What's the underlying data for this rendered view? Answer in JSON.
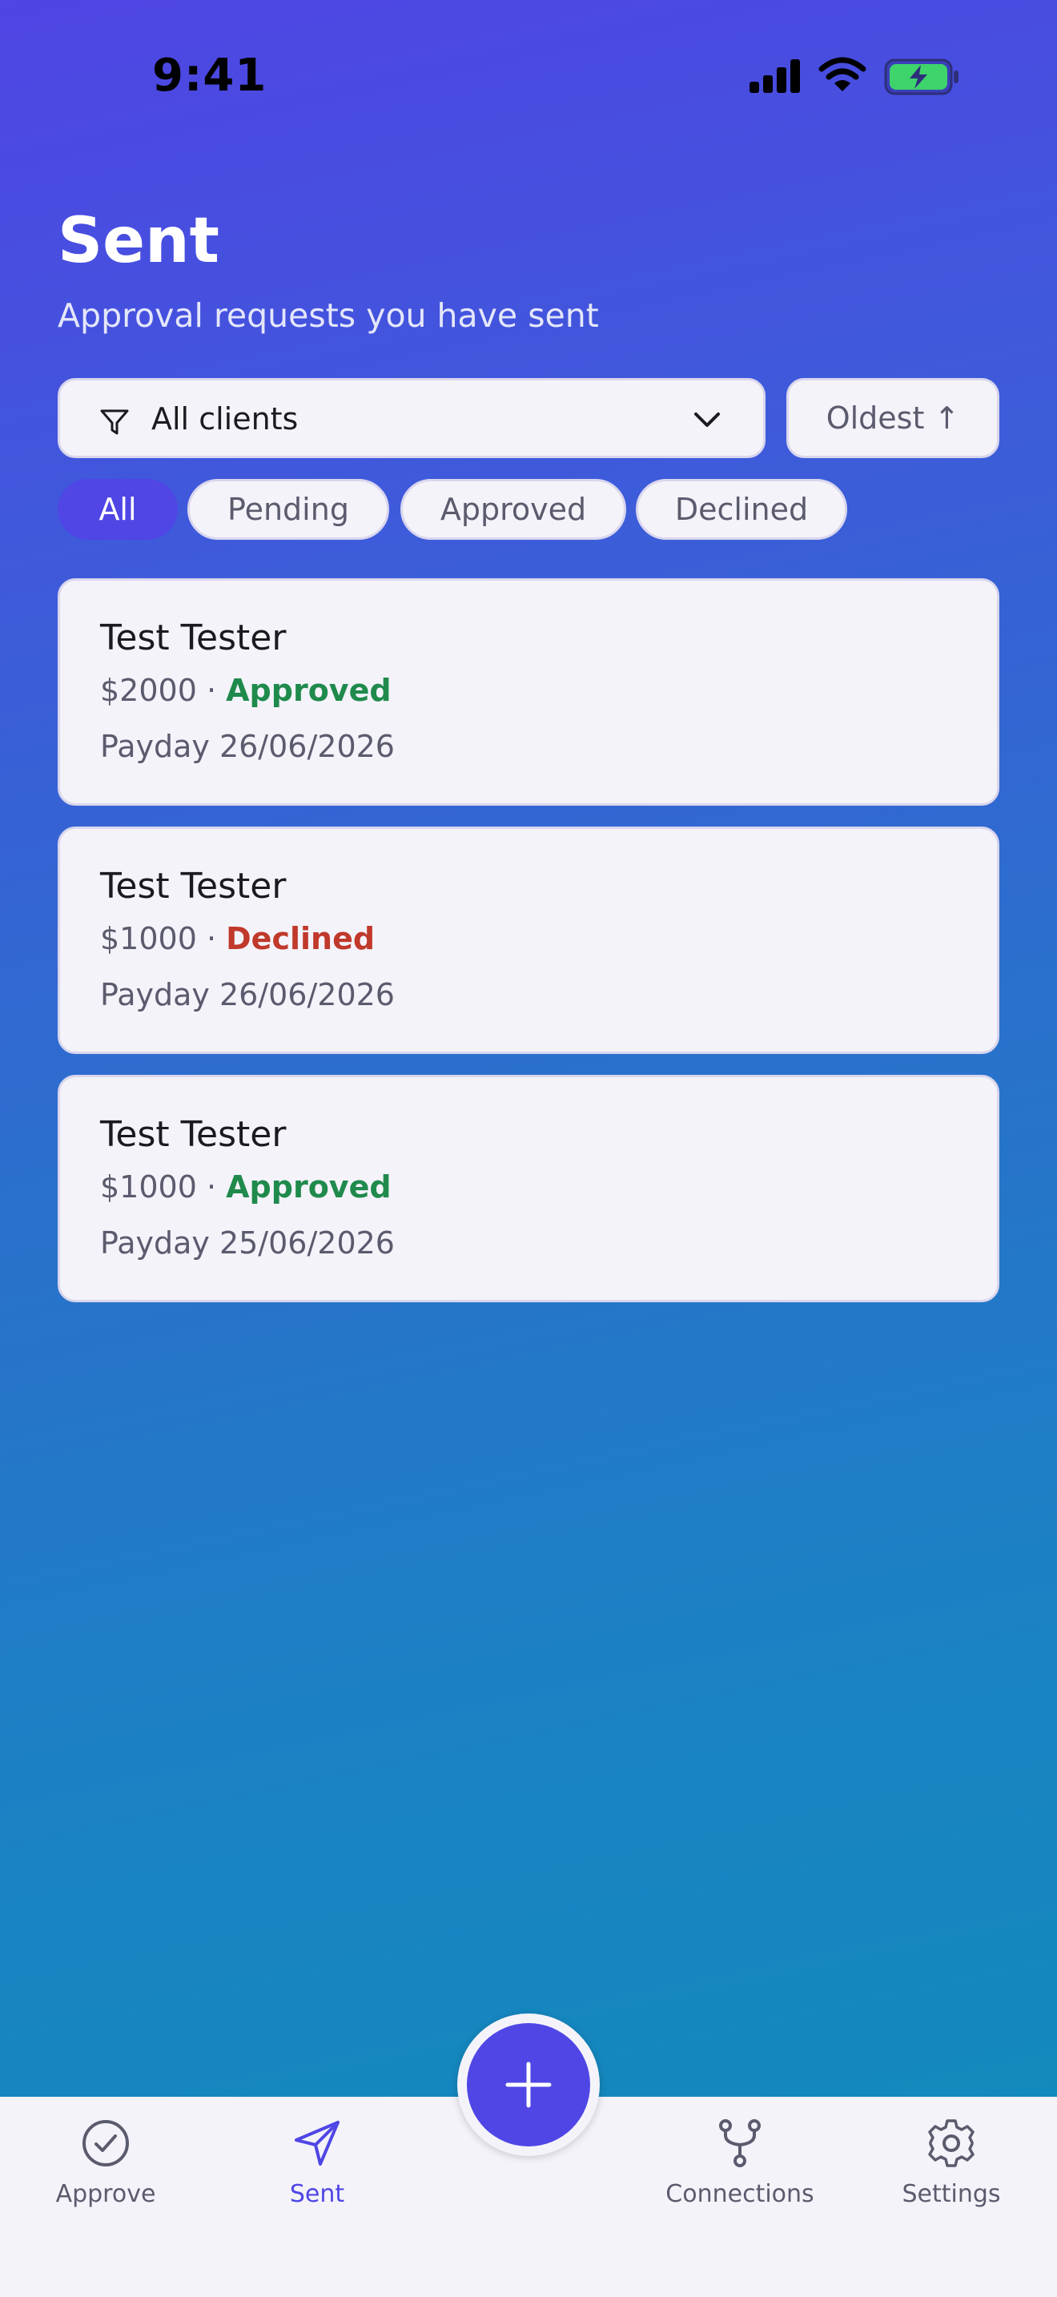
{
  "status_bar": {
    "time": "9:41"
  },
  "header": {
    "title": "Sent",
    "subtitle": "Approval requests you have sent"
  },
  "filters": {
    "client_filter_label": "All clients",
    "sort_label": "Oldest ↑",
    "chips": [
      {
        "label": "All",
        "active": true
      },
      {
        "label": "Pending",
        "active": false
      },
      {
        "label": "Approved",
        "active": false
      },
      {
        "label": "Declined",
        "active": false
      }
    ]
  },
  "requests": [
    {
      "name": "Test Tester",
      "amount": "$2000",
      "separator": " · ",
      "status": "Approved",
      "payday": "Payday 26/06/2026"
    },
    {
      "name": "Test Tester",
      "amount": "$1000",
      "separator": " · ",
      "status": "Declined",
      "payday": "Payday 26/06/2026"
    },
    {
      "name": "Test Tester",
      "amount": "$1000",
      "separator": " · ",
      "status": "Approved",
      "payday": "Payday 25/06/2026"
    }
  ],
  "tab_bar": {
    "tabs": [
      {
        "label": "Approve",
        "icon": "check-circle-icon",
        "active": false
      },
      {
        "label": "Sent",
        "icon": "paper-plane-icon",
        "active": true
      },
      {
        "label": "Connections",
        "icon": "branch-icon",
        "active": false
      },
      {
        "label": "Settings",
        "icon": "gear-icon",
        "active": false
      }
    ],
    "fab_icon": "plus-icon"
  },
  "colors": {
    "accent": "#4f46e5",
    "approved": "#1f8a4c",
    "declined": "#c0392b",
    "surface": "#f4f3fa",
    "muted_text": "#5b5b6e"
  }
}
